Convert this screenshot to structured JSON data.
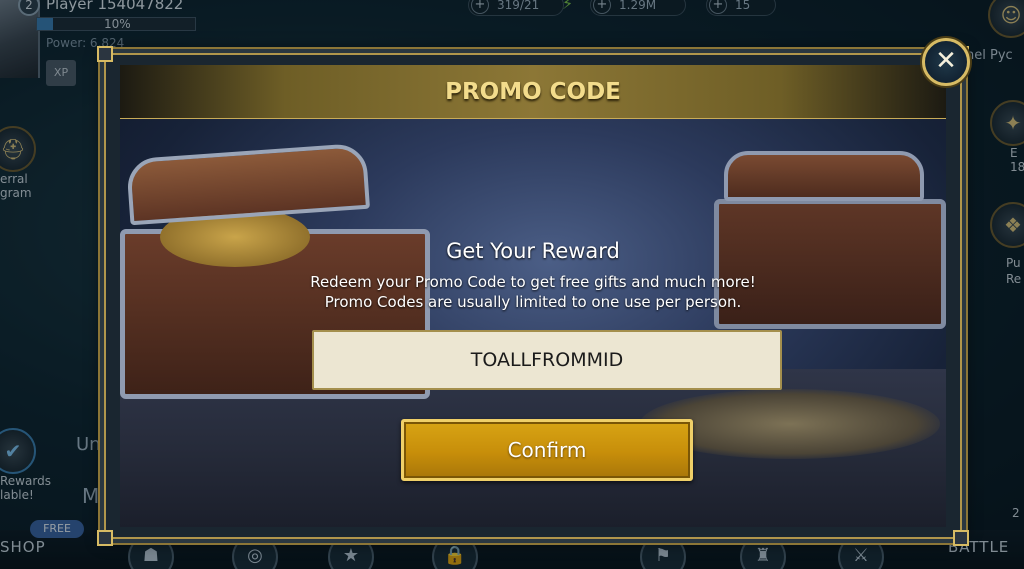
{
  "hud": {
    "level": "2",
    "player_name": "Player 154047822",
    "xp_percent_label": "10%",
    "xp_fraction": 0.1,
    "power_label": "Power: 6,824",
    "xp_tag": "XP",
    "resources": [
      {
        "icon": "plus-icon",
        "value": "319/21"
      },
      {
        "icon": "lightning-icon",
        "value": ""
      },
      {
        "icon": "plus-icon",
        "value": "1.29M"
      },
      {
        "icon": "plus-icon",
        "value": "15"
      }
    ],
    "left_labels": [
      "erral",
      "gram",
      "Unlo",
      "Rewards",
      "lable!",
      "Mi"
    ],
    "right_labels": [
      "nel Pyc",
      "E",
      "18",
      "Pu",
      "Re",
      "2"
    ],
    "free_tag": "FREE",
    "bottom_shop": "SHOP",
    "bottom_battle": "BATTLE"
  },
  "modal": {
    "title": "PROMO CODE",
    "heading": "Get Your Reward",
    "line1": "Redeem your Promo Code to get free gifts and much more!",
    "line2": "Promo Codes are usually limited to one use per person.",
    "code_value": "TOALLFROMMID",
    "confirm_label": "Confirm",
    "close_glyph": "✕"
  },
  "colors": {
    "accent_gold": "#d7bb64",
    "title_text": "#f3dc8c",
    "confirm_button": "#c78e0a",
    "input_bg": "#ece6d2"
  }
}
